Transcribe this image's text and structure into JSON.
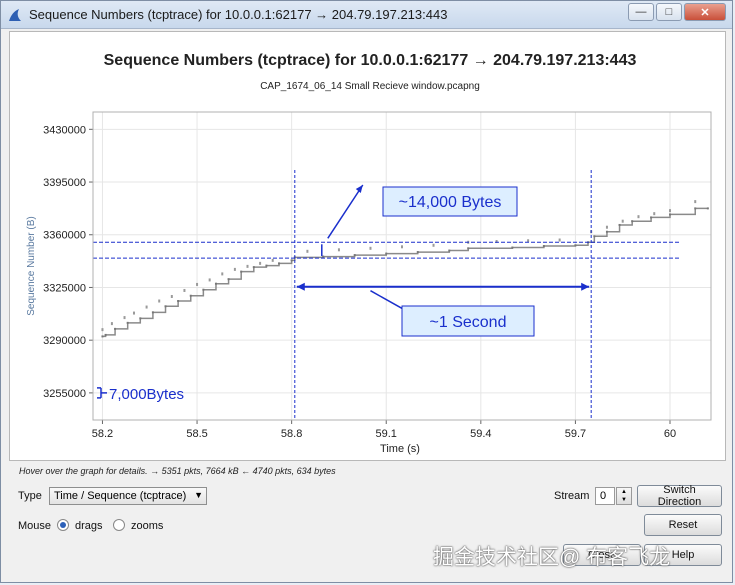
{
  "window": {
    "title": "Sequence Numbers (tcptrace) for 10.0.0.1:62177 → 204.79.197.213:443",
    "minimize_label": "—",
    "maximize_label": "□",
    "close_label": "✕",
    "icon": "shark-fin-icon"
  },
  "chart_data": {
    "type": "scatter",
    "title": "Sequence Numbers (tcptrace) for 10.0.0.1:62177 → 204.79.197.213:443",
    "subtitle": "CAP_1674_06_14 Small Recieve window.pcapng",
    "xlabel": "Time (s)",
    "ylabel": "Sequence Number (B)",
    "xlim": [
      58.17,
      60.13
    ],
    "ylim": [
      3237000,
      3441500
    ],
    "x_ticks": [
      58.2,
      58.5,
      58.8,
      59.1,
      59.4,
      59.7,
      60
    ],
    "x_tick_labels": [
      "58.2",
      "58.5",
      "58.8",
      "59.1",
      "59.4",
      "59.7",
      "60"
    ],
    "y_ticks": [
      3255000,
      3290000,
      3325000,
      3360000,
      3395000,
      3430000
    ],
    "y_tick_labels": [
      "3255000",
      "3290000",
      "3325000",
      "3360000",
      "3395000",
      "3430000"
    ],
    "grid": true,
    "series": [
      {
        "values": [
          [
            58.2,
            3292500
          ],
          [
            58.21,
            3293500
          ],
          [
            58.24,
            3297500
          ],
          [
            58.28,
            3301500
          ],
          [
            58.32,
            3304500
          ],
          [
            58.36,
            3308500
          ],
          [
            58.4,
            3312500
          ],
          [
            58.44,
            3316000
          ],
          [
            58.48,
            3319500
          ],
          [
            58.52,
            3323500
          ],
          [
            58.56,
            3327500
          ],
          [
            58.6,
            3330500
          ],
          [
            58.64,
            3335500
          ],
          [
            58.68,
            3338500
          ],
          [
            58.72,
            3339500
          ],
          [
            58.76,
            3341000
          ],
          [
            58.8,
            3343000
          ],
          [
            58.81,
            3345000
          ],
          [
            58.9,
            3345500
          ],
          [
            59.0,
            3346500
          ],
          [
            59.1,
            3347500
          ],
          [
            59.2,
            3348500
          ],
          [
            59.3,
            3349500
          ],
          [
            59.36,
            3351000
          ],
          [
            59.5,
            3351500
          ],
          [
            59.6,
            3352500
          ],
          [
            59.7,
            3353000
          ],
          [
            59.74,
            3355000
          ],
          [
            59.76,
            3359000
          ],
          [
            59.8,
            3362000
          ],
          [
            59.84,
            3366500
          ],
          [
            59.88,
            3369000
          ],
          [
            59.94,
            3371500
          ],
          [
            60.0,
            3373500
          ],
          [
            60.08,
            3377500
          ],
          [
            60.12,
            3377500
          ]
        ]
      },
      {
        "values": [
          [
            58.2,
            3297000
          ],
          [
            58.23,
            3301000
          ],
          [
            58.27,
            3305000
          ],
          [
            58.3,
            3308000
          ],
          [
            58.34,
            3312000
          ],
          [
            58.38,
            3316000
          ],
          [
            58.42,
            3319000
          ],
          [
            58.46,
            3323000
          ],
          [
            58.5,
            3327000
          ],
          [
            58.54,
            3330000
          ],
          [
            58.58,
            3334000
          ],
          [
            58.62,
            3337000
          ],
          [
            58.66,
            3339000
          ],
          [
            58.7,
            3341000
          ],
          [
            58.74,
            3343000
          ],
          [
            58.85,
            3349000
          ],
          [
            58.95,
            3350000
          ],
          [
            59.05,
            3351000
          ],
          [
            59.15,
            3352000
          ],
          [
            59.25,
            3353000
          ],
          [
            59.36,
            3355000
          ],
          [
            59.45,
            3355500
          ],
          [
            59.55,
            3356000
          ],
          [
            59.65,
            3356500
          ],
          [
            59.75,
            3362000
          ],
          [
            59.8,
            3365000
          ],
          [
            59.85,
            3369000
          ],
          [
            59.9,
            3372000
          ],
          [
            59.95,
            3374000
          ],
          [
            60.0,
            3376000
          ],
          [
            60.08,
            3382000
          ]
        ]
      }
    ],
    "annotations": [
      "~14,000 Bytes",
      "~1 Second",
      "7,000Bytes"
    ]
  },
  "controls": {
    "hover_info": "Hover over the graph for details. → 5351 pkts, 7664 kB ← 4740 pkts, 634 bytes",
    "type_label": "Type",
    "type_value": "Time / Sequence (tcptrace)",
    "stream_label": "Stream",
    "stream_value": "0",
    "switch_direction_label": "Switch Direction",
    "mouse_label": "Mouse",
    "drags_label": "drags",
    "zooms_label": "zooms",
    "mouse_mode": "drags",
    "reset_label": "Reset",
    "close_label": "Close",
    "help_label": "Help"
  },
  "watermark": "掘金技术社区@ 布客飞龙",
  "colors": {
    "annotation_blue": "#1a2fcc",
    "box_fill": "#ddeeff",
    "series": "#8a8a8a",
    "grid": "#e6e6e6"
  }
}
